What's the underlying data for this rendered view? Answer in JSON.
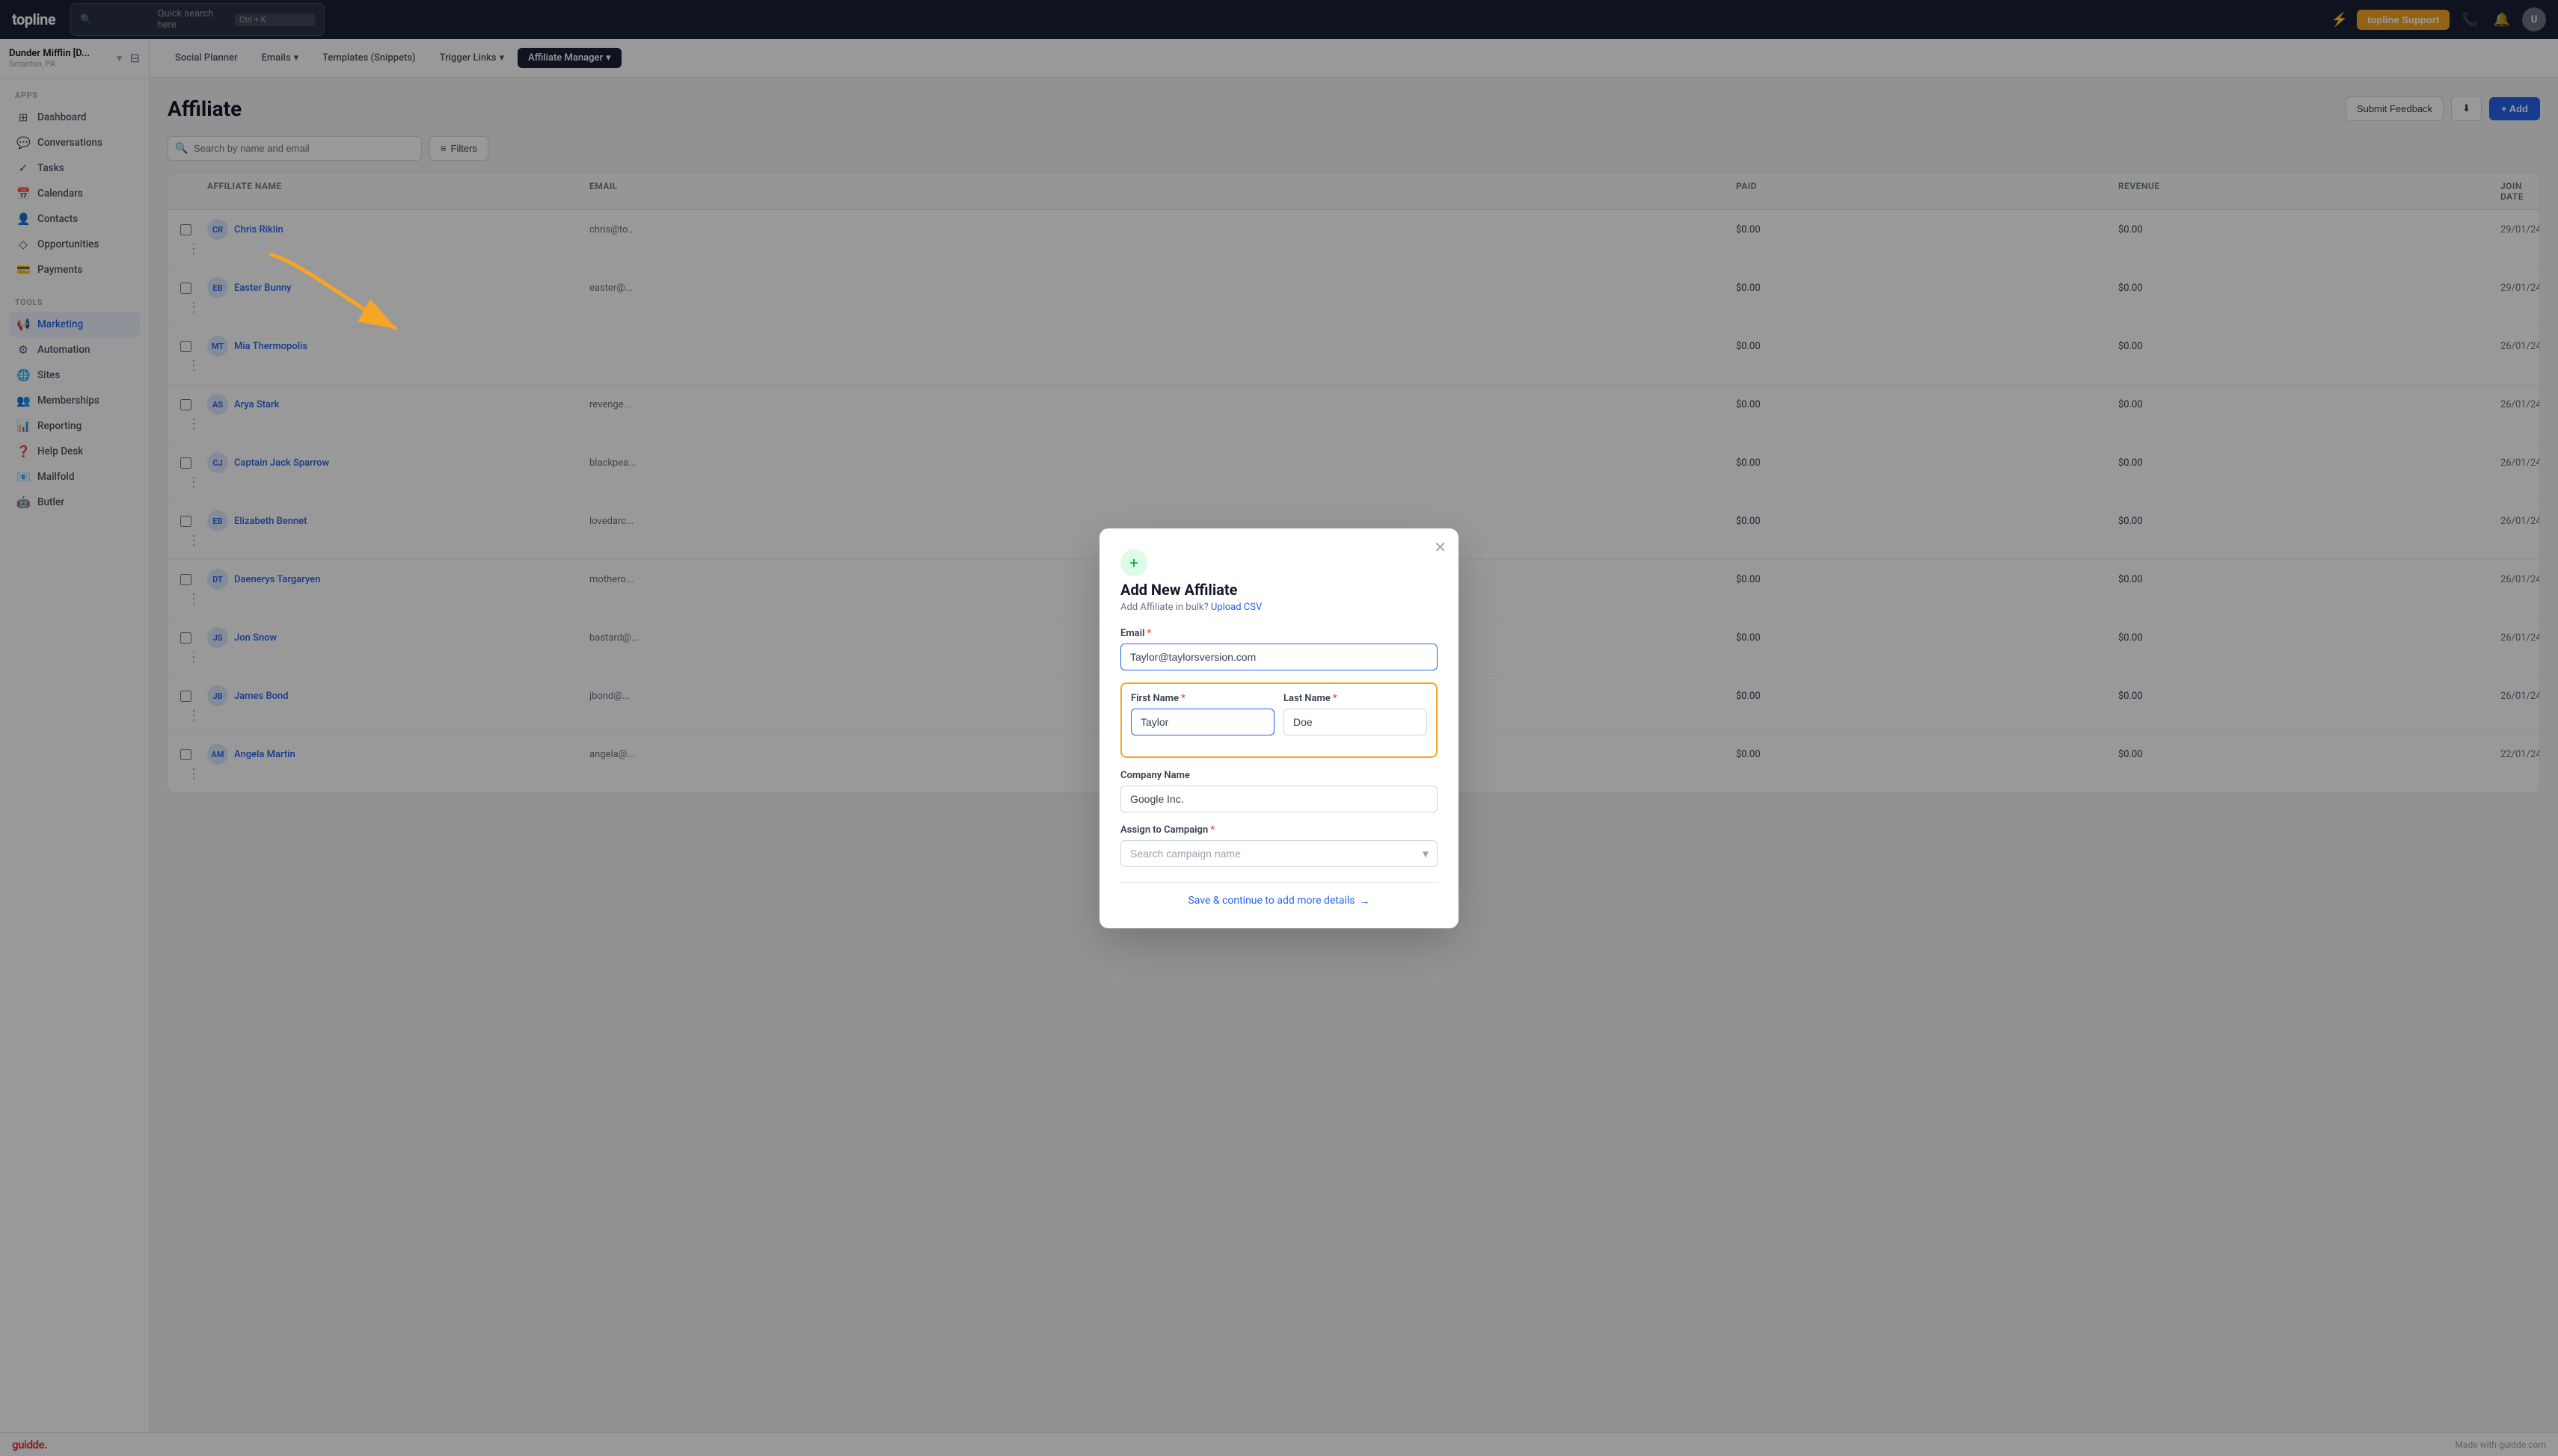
{
  "app": {
    "logo": "topline",
    "search_placeholder": "Quick search here",
    "search_shortcut": "Ctrl + K"
  },
  "topnav": {
    "support_label": "topline Support",
    "lightning_icon": "⚡"
  },
  "workspace": {
    "name": "Dunder Mifflin [D...",
    "location": "Scranton, PA"
  },
  "sidebar": {
    "apps_label": "Apps",
    "tools_label": "Tools",
    "items": [
      {
        "label": "Dashboard",
        "icon": "⊞",
        "active": false
      },
      {
        "label": "Conversations",
        "icon": "💬",
        "active": false
      },
      {
        "label": "Tasks",
        "icon": "✓",
        "active": false
      },
      {
        "label": "Calendars",
        "icon": "📅",
        "active": false
      },
      {
        "label": "Contacts",
        "icon": "👤",
        "active": false
      },
      {
        "label": "Opportunities",
        "icon": "◇",
        "active": false
      },
      {
        "label": "Payments",
        "icon": "💳",
        "active": false
      }
    ],
    "tools": [
      {
        "label": "Marketing",
        "icon": "📢",
        "active": true
      },
      {
        "label": "Automation",
        "icon": "⚙",
        "active": false
      },
      {
        "label": "Sites",
        "icon": "🌐",
        "active": false
      },
      {
        "label": "Memberships",
        "icon": "👥",
        "active": false
      },
      {
        "label": "Reporting",
        "icon": "📊",
        "active": false
      },
      {
        "label": "Help Desk",
        "icon": "❓",
        "active": false
      },
      {
        "label": "Mailfold",
        "icon": "📧",
        "active": false
      },
      {
        "label": "Butler",
        "icon": "🤖",
        "active": false
      }
    ]
  },
  "second_nav": {
    "tabs": [
      {
        "label": "Social Planner",
        "active": false
      },
      {
        "label": "Emails",
        "active": false,
        "has_dropdown": true
      },
      {
        "label": "Templates (Snippets)",
        "active": false
      },
      {
        "label": "Trigger Links",
        "active": false,
        "has_dropdown": true
      },
      {
        "label": "Affiliate Manager",
        "active": true,
        "has_dropdown": true
      }
    ]
  },
  "page": {
    "title": "Affiliate",
    "submit_feedback_label": "Submit Feedback",
    "add_label": "+ Add",
    "search_placeholder": "Search by name and email",
    "filter_label": "Filters"
  },
  "table": {
    "columns": [
      "",
      "Affiliate Name",
      "Email",
      "",
      "",
      "Paid",
      "Revenue",
      "Join Date",
      ""
    ],
    "rows": [
      {
        "name": "Chris Riklin",
        "email": "chris@to...",
        "paid": "$0.00",
        "revenue": "$0.00",
        "join_date": "29/01/24",
        "initials": "CR"
      },
      {
        "name": "Easter Bunny",
        "email": "easter@...",
        "paid": "$0.00",
        "revenue": "$0.00",
        "join_date": "29/01/24",
        "initials": "EB"
      },
      {
        "name": "Mia Thermopolis",
        "email": "",
        "paid": "$0.00",
        "revenue": "$0.00",
        "join_date": "26/01/24",
        "initials": "MT"
      },
      {
        "name": "Arya Stark",
        "email": "revenge...",
        "paid": "$0.00",
        "revenue": "$0.00",
        "join_date": "26/01/24",
        "initials": "AS"
      },
      {
        "name": "Captain Jack Sparrow",
        "email": "blackpea...",
        "paid": "$0.00",
        "revenue": "$0.00",
        "join_date": "26/01/24",
        "initials": "CJ"
      },
      {
        "name": "Elizabeth Bennet",
        "email": "lovedarc...",
        "paid": "$0.00",
        "revenue": "$0.00",
        "join_date": "26/01/24",
        "initials": "EB"
      },
      {
        "name": "Daenerys Targaryen",
        "email": "mothero...",
        "paid": "$0.00",
        "revenue": "$0.00",
        "join_date": "26/01/24",
        "initials": "DT"
      },
      {
        "name": "Jon Snow",
        "email": "bastard@...",
        "paid": "$0.00",
        "revenue": "$0.00",
        "join_date": "26/01/24",
        "initials": "JS"
      },
      {
        "name": "James Bond",
        "email": "jbond@...",
        "paid": "$0.00",
        "revenue": "$0.00",
        "join_date": "26/01/24",
        "initials": "JB"
      },
      {
        "name": "Angela Martin",
        "email": "angela@...",
        "paid": "$0.00",
        "revenue": "$0.00",
        "join_date": "22/01/24",
        "initials": "AM"
      }
    ]
  },
  "modal": {
    "plus_icon": "+",
    "title": "Add New Affiliate",
    "subtitle": "Add Affiliate in bulk?",
    "upload_csv_label": "Upload CSV",
    "email_label": "Email",
    "email_value": "Taylor@taylorsversion.com",
    "first_name_label": "First Name",
    "first_name_value": "Taylor",
    "last_name_label": "Last Name",
    "last_name_value": "Doe",
    "company_name_label": "Company Name",
    "company_name_value": "Google Inc.",
    "assign_campaign_label": "Assign to Campaign",
    "campaign_placeholder": "Search campaign name",
    "save_label": "Save & continue to add more details",
    "save_arrow": "→"
  },
  "bottom_bar": {
    "logo": "guidde.",
    "made_with": "Made with guidde.com"
  },
  "colors": {
    "primary": "#2563eb",
    "accent": "#f5a623",
    "danger": "#ef4444",
    "success": "#16a34a"
  }
}
